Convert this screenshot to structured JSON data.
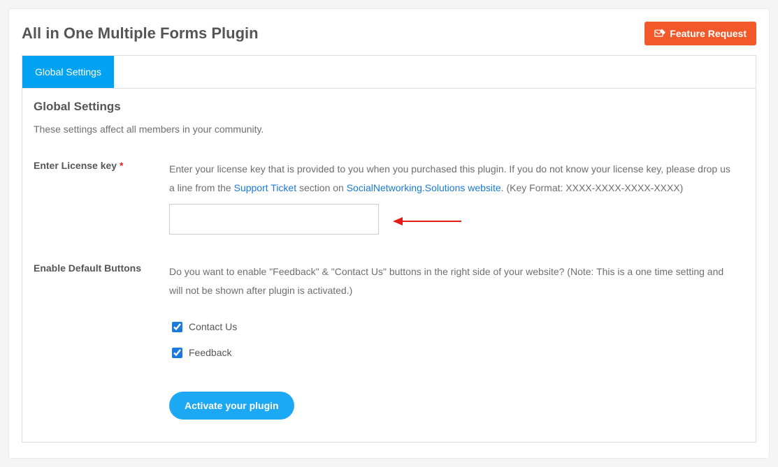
{
  "header": {
    "page_title": "All in One Multiple Forms Plugin",
    "feature_button": "Feature Request"
  },
  "tabs": {
    "global_settings": "Global Settings"
  },
  "section": {
    "title": "Global Settings",
    "description": "These settings affect all members in your community."
  },
  "license": {
    "label": "Enter License key",
    "desc_before_link1": "Enter your license key that is provided to you when you purchased this plugin. If you do not know your license key, please drop us a line from the ",
    "link1_text": "Support Ticket",
    "desc_mid": " section on ",
    "link2_text": "SocialNetworking.Solutions website",
    "desc_after_link2": ". (Key Format: XXXX-XXXX-XXXX-XXXX)",
    "value": ""
  },
  "default_buttons": {
    "label": "Enable Default Buttons",
    "description": "Do you want to enable \"Feedback\" & \"Contact Us\" buttons in the right side of your website? (Note: This is a one time setting and will not be shown after plugin is activated.)",
    "option_contact": "Contact Us",
    "option_feedback": "Feedback"
  },
  "submit": {
    "activate_label": "Activate your plugin"
  }
}
